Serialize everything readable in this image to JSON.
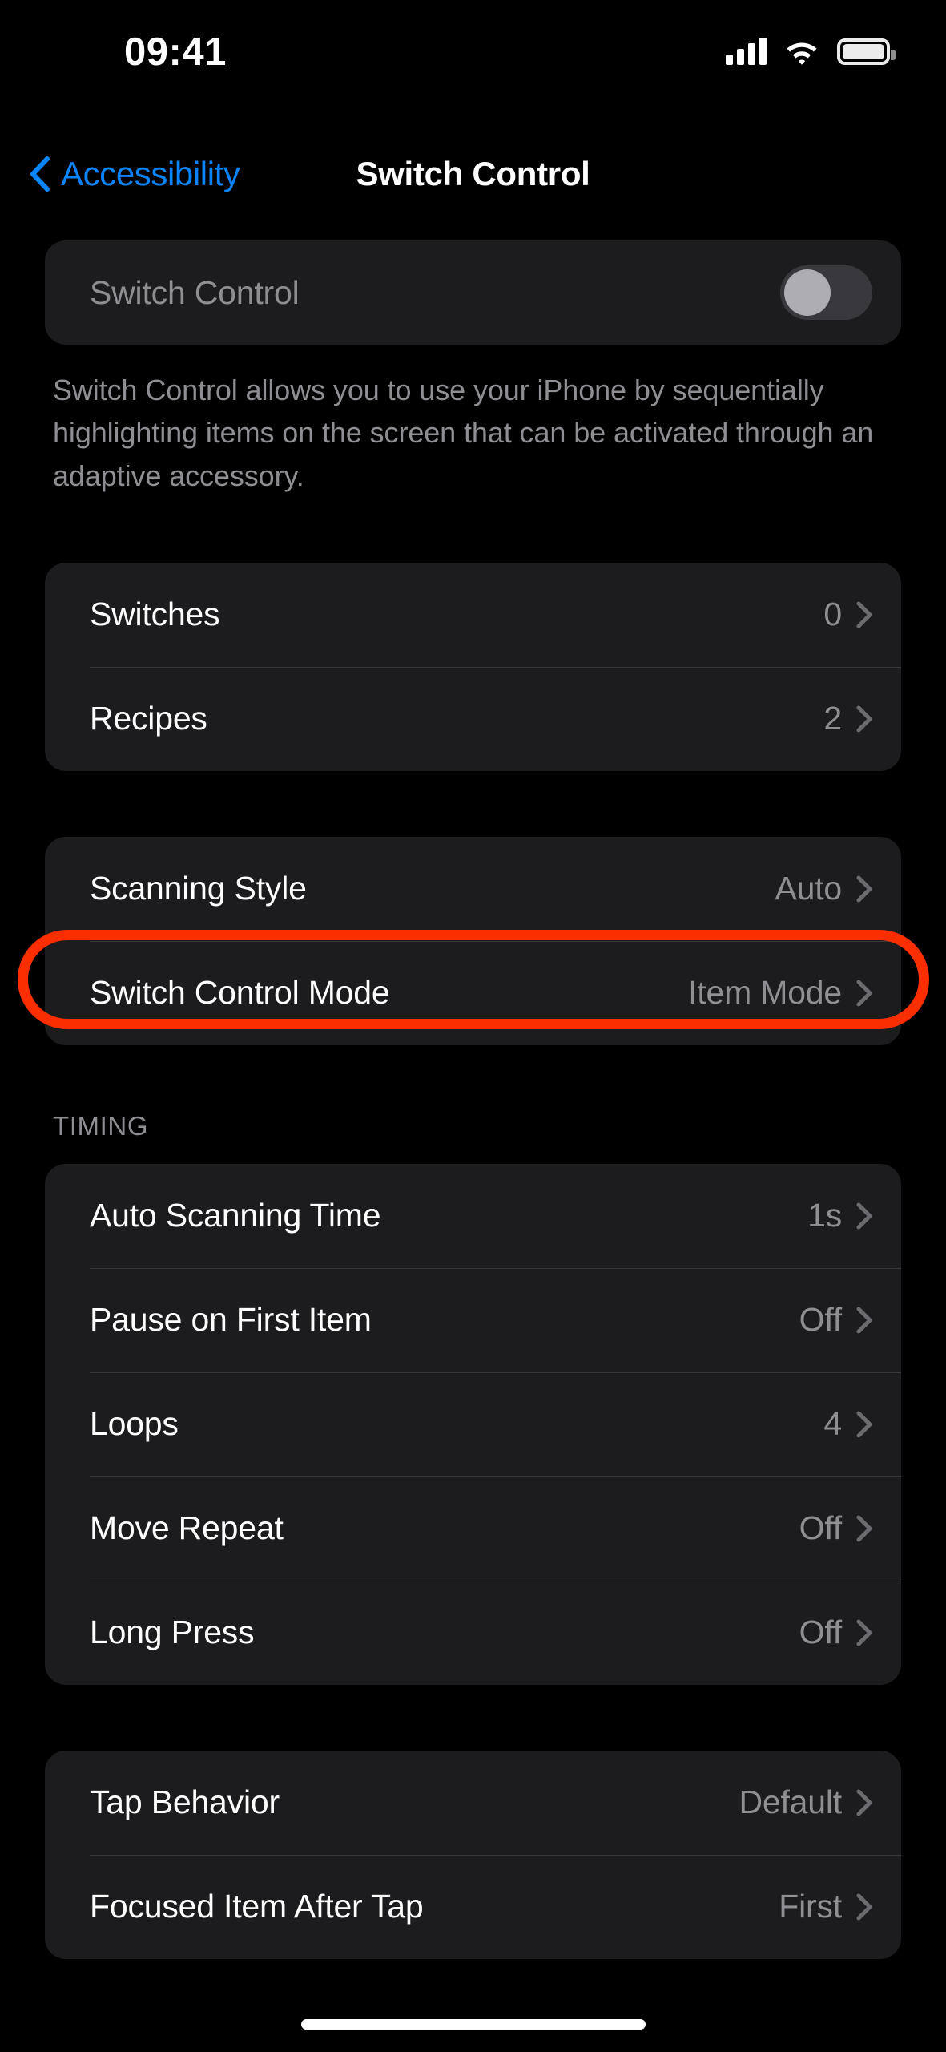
{
  "status_bar": {
    "time": "09:41",
    "icons": [
      "cellular-signal-icon",
      "wifi-icon",
      "battery-icon"
    ]
  },
  "nav": {
    "back_label": "Accessibility",
    "back_icon": "chevron-left-icon",
    "title": "Switch Control"
  },
  "main": {
    "toggle_row": {
      "label": "Switch Control",
      "toggle_state": "off"
    },
    "footnote": "Switch Control allows you to use your iPhone by sequentially highlighting items on the screen that can be activated through an adaptive accessory.",
    "group_switches": [
      {
        "label": "Switches",
        "value": "0"
      },
      {
        "label": "Recipes",
        "value": "2"
      }
    ],
    "group_scanning": [
      {
        "label": "Scanning Style",
        "value": "Auto"
      },
      {
        "label": "Switch Control Mode",
        "value": "Item Mode"
      }
    ],
    "timing_header": "TIMING",
    "group_timing": [
      {
        "label": "Auto Scanning Time",
        "value": "1s"
      },
      {
        "label": "Pause on First Item",
        "value": "Off"
      },
      {
        "label": "Loops",
        "value": "4"
      },
      {
        "label": "Move Repeat",
        "value": "Off"
      },
      {
        "label": "Long Press",
        "value": "Off"
      }
    ],
    "group_tap": [
      {
        "label": "Tap Behavior",
        "value": "Default"
      },
      {
        "label": "Focused Item After Tap",
        "value": "First"
      }
    ]
  },
  "annotation": {
    "target": "Switch Control Mode",
    "color": "#FA2E00",
    "shape": "rounded-rectangle-outline"
  },
  "colors": {
    "background": "#000000",
    "card": "#1C1C1E",
    "separator": "#38383A",
    "primary_text": "#FFFFFF",
    "secondary_text": "#8E8E93",
    "accent_blue": "#0A84FF",
    "toggle_track_off": "#39393D",
    "toggle_knob": "#AEAEB2",
    "annotation_red": "#FA2E00"
  }
}
